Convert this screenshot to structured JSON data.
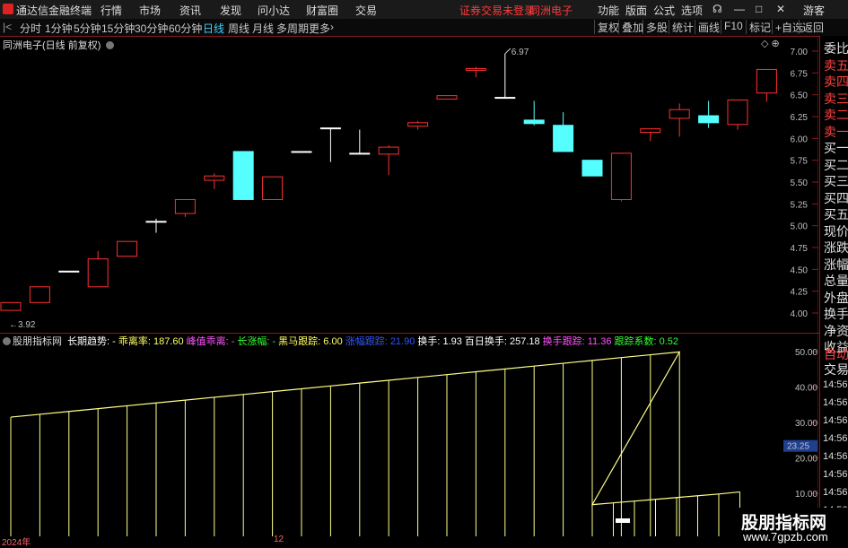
{
  "titlebar": {
    "app_title": "通达信金融终端",
    "menu": [
      "行情",
      "市场",
      "资讯",
      "发现",
      "问小达",
      "财富圈",
      "交易"
    ],
    "notice": "证券交易未登录",
    "stock_name": "同洲电子",
    "right_menu": [
      "功能",
      "版面",
      "公式",
      "选项"
    ],
    "user": "游客"
  },
  "periodbar": {
    "periods": [
      "分时",
      "1分钟",
      "5分钟",
      "15分钟",
      "30分钟",
      "60分钟",
      "日线",
      "周线",
      "月线",
      "多周期",
      "更多"
    ],
    "active": "日线",
    "tools": [
      "复权",
      "叠加",
      "多股",
      "统计",
      "画线",
      "F10",
      "标记",
      "+自选",
      "返回"
    ]
  },
  "main_chart": {
    "label": "同洲电子(日线 前复权)",
    "high_marker": "6.97",
    "low_marker": "3.92",
    "yticks": [
      "7.00",
      "6.75",
      "6.50",
      "6.25",
      "6.00",
      "5.75",
      "5.50",
      "5.25",
      "5.00",
      "4.75",
      "4.50",
      "4.25",
      "4.00"
    ]
  },
  "chart_data": {
    "type": "candlestick",
    "ylim": [
      3.85,
      7.1
    ],
    "candles": [
      {
        "o": 4.03,
        "c": 4.12,
        "h": 4.12,
        "l": 4.03,
        "color": "up"
      },
      {
        "o": 4.12,
        "c": 4.3,
        "h": 4.3,
        "l": 4.12,
        "color": "up"
      },
      {
        "o": 4.48,
        "c": 4.48,
        "h": 4.48,
        "l": 4.48,
        "color": "flat"
      },
      {
        "o": 4.3,
        "c": 4.62,
        "h": 4.71,
        "l": 4.3,
        "color": "up"
      },
      {
        "o": 4.65,
        "c": 4.82,
        "h": 4.82,
        "l": 4.65,
        "color": "up"
      },
      {
        "o": 5.05,
        "c": 5.05,
        "h": 5.08,
        "l": 4.92,
        "color": "flat"
      },
      {
        "o": 5.14,
        "c": 5.3,
        "h": 5.3,
        "l": 5.1,
        "color": "up"
      },
      {
        "o": 5.52,
        "c": 5.57,
        "h": 5.6,
        "l": 5.42,
        "color": "up"
      },
      {
        "o": 5.85,
        "c": 5.3,
        "h": 5.85,
        "l": 5.3,
        "color": "cyan"
      },
      {
        "o": 5.3,
        "c": 5.56,
        "h": 5.56,
        "l": 5.3,
        "color": "up"
      },
      {
        "o": 5.85,
        "c": 5.85,
        "h": 5.85,
        "l": 5.85,
        "color": "flat"
      },
      {
        "o": 6.12,
        "c": 6.12,
        "h": 6.12,
        "l": 5.73,
        "color": "flat"
      },
      {
        "o": 5.83,
        "c": 5.83,
        "h": 6.1,
        "l": 5.83,
        "color": "flat"
      },
      {
        "o": 5.82,
        "c": 5.9,
        "h": 5.92,
        "l": 5.58,
        "color": "up"
      },
      {
        "o": 6.14,
        "c": 6.18,
        "h": 6.2,
        "l": 6.1,
        "color": "up"
      },
      {
        "o": 6.45,
        "c": 6.49,
        "h": 6.49,
        "l": 6.45,
        "color": "up"
      },
      {
        "o": 6.78,
        "c": 6.8,
        "h": 6.82,
        "l": 6.7,
        "color": "up"
      },
      {
        "o": 6.47,
        "c": 6.47,
        "h": 6.97,
        "l": 6.47,
        "color": "flat"
      },
      {
        "o": 6.21,
        "c": 6.17,
        "h": 6.43,
        "l": 6.15,
        "color": "cyan"
      },
      {
        "o": 6.15,
        "c": 5.85,
        "h": 6.3,
        "l": 5.85,
        "color": "cyan"
      },
      {
        "o": 5.75,
        "c": 5.57,
        "h": 5.75,
        "l": 5.57,
        "color": "cyan"
      },
      {
        "o": 5.3,
        "c": 5.83,
        "h": 5.83,
        "l": 5.28,
        "color": "up"
      },
      {
        "o": 6.07,
        "c": 6.11,
        "h": 6.11,
        "l": 5.97,
        "color": "up"
      },
      {
        "o": 6.23,
        "c": 6.33,
        "h": 6.4,
        "l": 6.02,
        "color": "up"
      },
      {
        "o": 6.26,
        "c": 6.18,
        "h": 6.43,
        "l": 6.12,
        "color": "cyan"
      },
      {
        "o": 6.16,
        "c": 6.44,
        "h": 6.44,
        "l": 6.1,
        "color": "up"
      },
      {
        "o": 6.52,
        "c": 6.79,
        "h": 6.79,
        "l": 6.42,
        "color": "up"
      }
    ],
    "indicator": {
      "ylim": [
        5,
        55
      ],
      "yticks": [
        "50.00",
        "40.00",
        "30.00",
        "20.00",
        "10.00"
      ],
      "values": [
        31.5,
        32.3,
        33.1,
        33.9,
        34.7,
        35.5,
        36.3,
        37.1,
        37.9,
        38.7,
        39.5,
        40.3,
        41.1,
        41.9,
        42.7,
        43.5,
        44.3,
        45.1,
        45.9,
        46.7,
        47.5,
        48.3,
        49.1,
        49.9,
        6.8,
        7.3,
        7.8,
        8.3,
        8.8,
        9.3,
        9.8,
        10.4
      ],
      "current": "23.25"
    }
  },
  "indicator_legend": {
    "name": "股朋指标网",
    "items": [
      {
        "text": "长期趋势: -",
        "color": "#ffffff"
      },
      {
        "text": "乖离率: 187.60",
        "color": "#ffff66"
      },
      {
        "text": "峰值乖离: -",
        "color": "#ff55ff"
      },
      {
        "text": "长涨幅: -",
        "color": "#33ff33"
      },
      {
        "text": "黑马跟踪: 6.00",
        "color": "#ffff66"
      },
      {
        "text": "涨幅跟踪: 21.90",
        "color": "#3355ff"
      },
      {
        "text": "换手: 1.93",
        "color": "#ffffff"
      },
      {
        "text": "百日换手: 257.18",
        "color": "#ffffff"
      },
      {
        "text": "换手跟踪: 11.36",
        "color": "#ff55ff"
      },
      {
        "text": "跟踪系数: 0.52",
        "color": "#33ff33"
      }
    ]
  },
  "side_panel": {
    "labels": [
      "委比",
      "卖五",
      "卖四",
      "卖三",
      "卖二",
      "卖一",
      "买一",
      "买二",
      "买三",
      "买四",
      "买五",
      "现价",
      "涨跌",
      "涨幅",
      "总量",
      "外盘",
      "换手",
      "净资",
      "收益"
    ],
    "auto_label": "自动",
    "trade_label": "交易",
    "times": [
      "14:56",
      "14:56",
      "14:56",
      "14:56",
      "14:56",
      "14:56",
      "14:56",
      "14:56",
      "14:56"
    ]
  },
  "dates": {
    "d1": "2024年",
    "d2": "12"
  },
  "watermark": {
    "title": "股朋指标网",
    "url": "www.7gpzb.com"
  },
  "colors": {
    "up": "#ff3030",
    "cyan": "#55ffff",
    "flat": "#ffffff",
    "indicator": "#ffff88",
    "border": "#8b1a1a"
  }
}
